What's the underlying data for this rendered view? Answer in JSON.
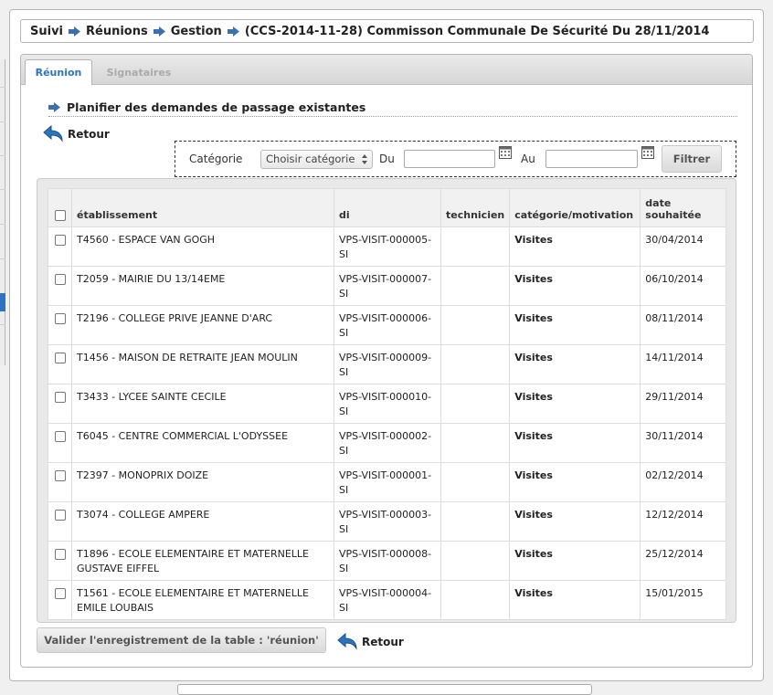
{
  "breadcrumb": {
    "items": [
      "Suivi",
      "Réunions",
      "Gestion",
      "(CCS-2014-11-28) Commisson Communale De Sécurité Du 28/11/2014"
    ]
  },
  "tabs": [
    {
      "label": "Réunion",
      "active": true
    },
    {
      "label": "Signataires",
      "active": false
    }
  ],
  "section": {
    "title": "Planifier des demandes de passage existantes"
  },
  "retour_label": "Retour",
  "filter": {
    "categorie_label": "Catégorie",
    "categorie_value": "Choisir catégorie",
    "du_label": "Du",
    "au_label": "Au",
    "du_value": "",
    "au_value": "",
    "filtrer_label": "Filtrer"
  },
  "table": {
    "headers": [
      "établissement",
      "di",
      "technicien",
      "catégorie/motivation",
      "date souhaitée"
    ],
    "rows": [
      {
        "etab": "T4560 - ESPACE VAN GOGH",
        "di": "VPS-VISIT-000005-SI",
        "tech": "",
        "cat": "Visites",
        "date": "30/04/2014"
      },
      {
        "etab": "T2059 - MAIRIE DU 13/14EME",
        "di": "VPS-VISIT-000007-SI",
        "tech": "",
        "cat": "Visites",
        "date": "06/10/2014"
      },
      {
        "etab": "T2196 - COLLEGE PRIVE JEANNE D'ARC",
        "di": "VPS-VISIT-000006-SI",
        "tech": "",
        "cat": "Visites",
        "date": "08/11/2014"
      },
      {
        "etab": "T1456 - MAISON DE RETRAITE JEAN MOULIN",
        "di": "VPS-VISIT-000009-SI",
        "tech": "",
        "cat": "Visites",
        "date": "14/11/2014"
      },
      {
        "etab": "T3433 - LYCEE SAINTE CECILE",
        "di": "VPS-VISIT-000010-SI",
        "tech": "",
        "cat": "Visites",
        "date": "29/11/2014"
      },
      {
        "etab": "T6045 - CENTRE COMMERCIAL L'ODYSSEE",
        "di": "VPS-VISIT-000002-SI",
        "tech": "",
        "cat": "Visites",
        "date": "30/11/2014"
      },
      {
        "etab": "T2397 - MONOPRIX DOIZE",
        "di": "VPS-VISIT-000001-SI",
        "tech": "",
        "cat": "Visites",
        "date": "02/12/2014"
      },
      {
        "etab": "T3074 - COLLEGE AMPERE",
        "di": "VPS-VISIT-000003-SI",
        "tech": "",
        "cat": "Visites",
        "date": "12/12/2014"
      },
      {
        "etab": "T1896 - ECOLE ELEMENTAIRE ET MATERNELLE GUSTAVE EIFFEL",
        "di": "VPS-VISIT-000008-SI",
        "tech": "",
        "cat": "Visites",
        "date": "25/12/2014"
      },
      {
        "etab": "T1561 - ECOLE ELEMENTAIRE ET MATERNELLE EMILE LOUBAIS",
        "di": "VPS-VISIT-000004-SI",
        "tech": "",
        "cat": "Visites",
        "date": "15/01/2015"
      }
    ]
  },
  "valider_label": "Valider l'enregistrement de la table : 'réunion'",
  "colors": {
    "accent": "#2d74c0",
    "border": "#b5b5b5"
  }
}
